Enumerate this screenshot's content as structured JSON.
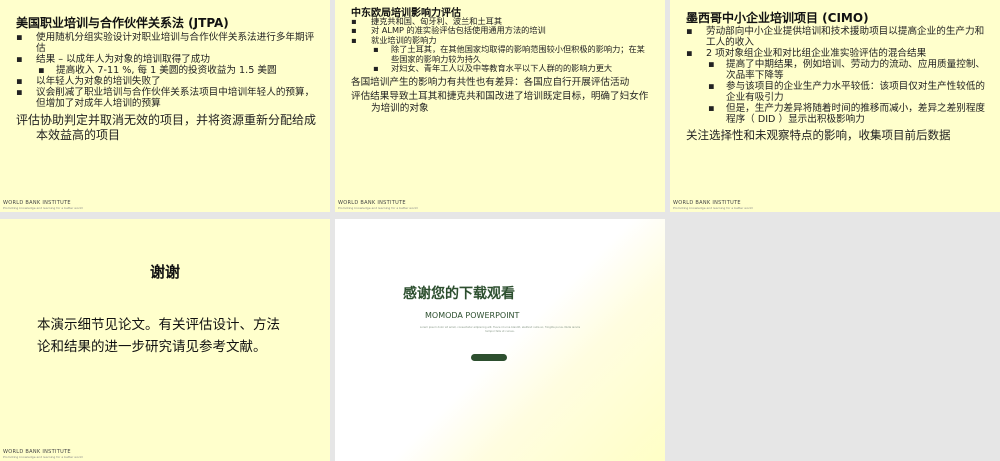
{
  "footer": {
    "brand": "WORLD BANK INSTITUTE",
    "tagline": "Promoting knowledge and learning for a better world"
  },
  "slides": {
    "jtpa": {
      "title": "美国职业培训与合作伙伴关系法 (JTPA)",
      "bullets": [
        "使用随机分组实验设计对职业培训与合作伙伴关系法进行多年期评估",
        "结果 – 以成年人为对象的培训取得了成功",
        "提高收入 7-11 %, 每 1 美圆的投资收益为 1.5 美圆",
        "以年轻人为对象的培训失败了",
        "议会削减了职业培训与合作伙伴关系法项目中培训年轻人的预算，但增加了对成年人培训的预算"
      ],
      "paragraph": "评估协助判定并取消无效的项目，并将资源重新分配给成本效益高的项目"
    },
    "ceu": {
      "title": "中东欧局培训影响力评估",
      "bullets": [
        "捷克共和国、匈牙利、波兰和土耳其",
        "对 ALMP 的准实验评估包括使用通用方法的培训",
        "就业培训的影响力",
        "除了土耳其，在其他国家均取得的影响范围较小但积极的影响力；在某些国家的影响力较为持久",
        "对妇女、青年工人以及中等教育水平以下人群的的影响力更大"
      ],
      "paragraphs": [
        "各国培训产生的影响力有共性也有差异：各国应自行开展评估活动",
        "评估结果导致土耳其和捷克共和国改进了培训既定目标，明确了妇女作为培训的对象"
      ]
    },
    "cimo": {
      "title": "墨西哥中小企业培训项目 (CIMO)",
      "bullets": [
        "劳动部向中小企业提供培训和技术援助项目以提高企业的生产力和工人的收入",
        "2 项对象组企业和对比组企业准实验评估的混合结果",
        "提高了中期结果，例如培训、劳动力的流动、应用质量控制、次品率下降等",
        "参与该项目的企业生产力水平较低：该项目仅对生产性较低的企业有吸引力",
        "但是，生产力差异将随着时间的推移而减小，差异之差别程度程序（ DID ）显示出积极影响力"
      ],
      "paragraph": "关注选择性和未观察特点的影响，收集项目前后数据"
    },
    "thanks": {
      "title": "谢谢",
      "body": "本演示细节见论文。有关评估设计、方法论和结果的进一步研究请见参考文献。"
    },
    "download": {
      "title": "感谢您的下载观看",
      "subtitle": "MOMODA POWERPOINT",
      "fine_print": "Lorem ipsum dolor sit amet, consectetur adipiscing elit. Fusce id urna blandit, eleifend nulla ac, fringilla purus. Nulla iaculis tempor felis ut cursus."
    }
  }
}
